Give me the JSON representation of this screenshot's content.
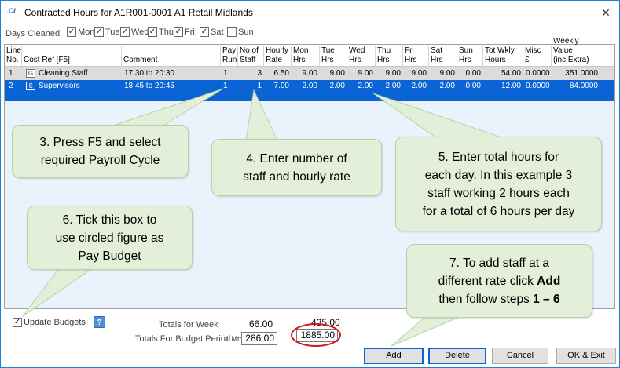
{
  "window": {
    "app_icon": ".CL",
    "title": "Contracted Hours for A1R001-0001 A1 Retail Midlands",
    "close_glyph": "✕"
  },
  "days_cleaned": {
    "label": "Days Cleaned",
    "days": [
      {
        "label": "Mon",
        "checked": true
      },
      {
        "label": "Tue",
        "checked": true
      },
      {
        "label": "Wed",
        "checked": true
      },
      {
        "label": "Thu",
        "checked": true
      },
      {
        "label": "Fri",
        "checked": true
      },
      {
        "label": "Sat",
        "checked": true
      },
      {
        "label": "Sun",
        "checked": false
      }
    ]
  },
  "grid": {
    "headers": [
      "Line\nNo.",
      "Cost Ref [F5]",
      "Comment",
      "Pay\nRun",
      "No of\nStaff",
      "Hourly\nRate",
      "Mon\nHrs",
      "Tue\nHrs",
      "Wed\nHrs",
      "Thu\nHrs",
      "Fri\nHrs",
      "Sat Hrs",
      "Sun\nHrs",
      "Tot Wkly\nHours",
      "Misc\n£",
      "Weekly Value\n(inc Extra)"
    ],
    "rows": [
      {
        "line": "1",
        "cost_icon": "G",
        "cost_ref": "Cleaning Staff",
        "comment": "17:30 to 20:30",
        "pay_run": "1",
        "staff": "3",
        "rate": "6.50",
        "mon": "9.00",
        "tue": "9.00",
        "wed": "9.00",
        "thu": "9.00",
        "fri": "9.00",
        "sat": "9.00",
        "sun": "0.00",
        "tot": "54.00",
        "misc": "0.0000",
        "value": "351.0000"
      },
      {
        "line": "2",
        "cost_icon": "S",
        "cost_ref": "Supervisors",
        "comment": "18:45 to 20:45",
        "pay_run": "1",
        "staff": "1",
        "rate": "7.00",
        "mon": "2.00",
        "tue": "2.00",
        "wed": "2.00",
        "thu": "2.00",
        "fri": "2.00",
        "sat": "2.00",
        "sun": "0.00",
        "tot": "12.00",
        "misc": "0.0000",
        "value": "84.0000"
      }
    ]
  },
  "callouts": {
    "c3": {
      "line1": "3.   Press F5 and select",
      "line2": "required Payroll Cycle"
    },
    "c4": {
      "line1": "4.   Enter number of",
      "line2": "staff and hourly rate"
    },
    "c5": {
      "line1": "5.   Enter total hours for",
      "line2": "each day.  In this example 3",
      "line3": "staff working 2 hours each",
      "line4": "for a total of 6 hours per day"
    },
    "c6": {
      "line1": "6.   Tick this box to",
      "line2": "use circled figure as",
      "line3": "Pay Budget"
    },
    "c7": {
      "line1": "7.   To add staff at a",
      "line2a": "different rate click ",
      "line2b": "Add",
      "line3a": "then follow steps ",
      "line3b": "1 – 6"
    }
  },
  "footer": {
    "update_budgets": {
      "label": "Update Budgets",
      "checked": true
    },
    "help": "?",
    "totals_week_label": "Totals for Week",
    "totals_week_hours": "66.00",
    "totals_week_value": "435.00",
    "totals_period_label": "Totals For Budget Period",
    "period_unit": "1 Mth",
    "period_hours": "286.00",
    "period_value": "1885.00"
  },
  "buttons": {
    "add": "Add",
    "delete": "Delete",
    "cancel": "Cancel",
    "ok_exit": "OK & Exit"
  },
  "colors": {
    "selection": "#0a64d6",
    "callout_fill": "#e3efd9",
    "highlight_ellipse": "#d01818"
  }
}
